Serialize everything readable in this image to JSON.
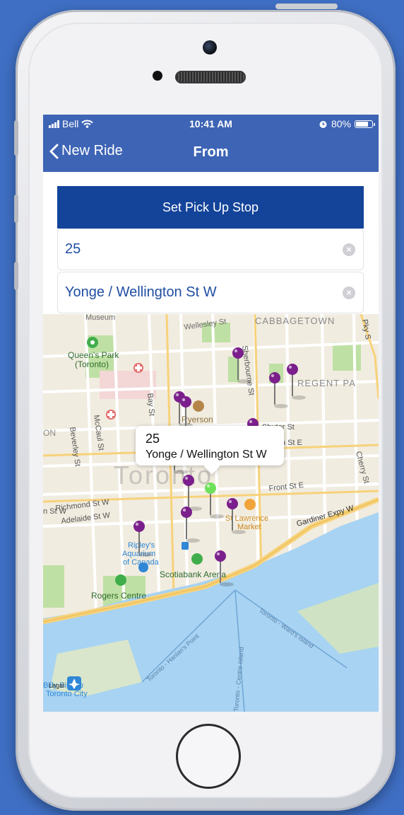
{
  "status_bar": {
    "carrier": "Bell",
    "time": "10:41 AM",
    "battery_percent": "80%",
    "battery_level": 0.8,
    "icons": [
      "signal-icon",
      "wifi-icon",
      "alarm-icon",
      "battery-icon"
    ]
  },
  "nav": {
    "back_label": "New Ride",
    "title": "From"
  },
  "form": {
    "pickup_button_label": "Set Pick Up Stop",
    "stop_number_value": "25",
    "stop_name_value": "Yonge / Wellington St W"
  },
  "map": {
    "callout": {
      "title": "25",
      "subtitle": "Yonge / Wellington St W"
    },
    "labels": {
      "museum": "Museum",
      "wellesley": "Wellesley St",
      "cabbagetown": "CABBAGETOWN",
      "pky": "Pky S",
      "queens_park": "Queen's Park",
      "toronto_paren": "(Toronto)",
      "sherbourne": "Sherbourne St",
      "regent_park": "REGENT PA",
      "bay_st": "Bay St",
      "ryerson": "Ryerson",
      "on": "ON",
      "beverley": "Beverley St",
      "mccaul": "McCaul St",
      "shuter": "Shuter St",
      "queen_e": "Queen St E",
      "toronto_big": "Toronto",
      "cherry": "Cherry St",
      "front_e": "Front St E",
      "richmond": "Richmond St W",
      "adelaide": "Adelaide St W",
      "gardiner": "Gardiner Expy W",
      "n_st_w": "n St W",
      "st_lawrence": "St Lawrence",
      "market": "Market",
      "ripleys": "Ripley's",
      "aquarium": "Aquarium",
      "of_canada": "of Canada",
      "scotiabank": "Scotiabank Arena",
      "rogers": "Rogers Centre",
      "hanlans": "Toronto - Hanlan's Point",
      "centre_island": "Toronto - Centre Island",
      "wards": "Toronto - Ward's Island",
      "billy_bishop": "Billy Bishop",
      "toronto_city": "Toronto City",
      "legal": "Legal"
    },
    "colors": {
      "stop_pin": "#7b1f8c",
      "selected_pin": "#6ee05a",
      "water": "#a8d3f2",
      "park": "#bfe0a4",
      "highway": "#f7d27a"
    }
  }
}
